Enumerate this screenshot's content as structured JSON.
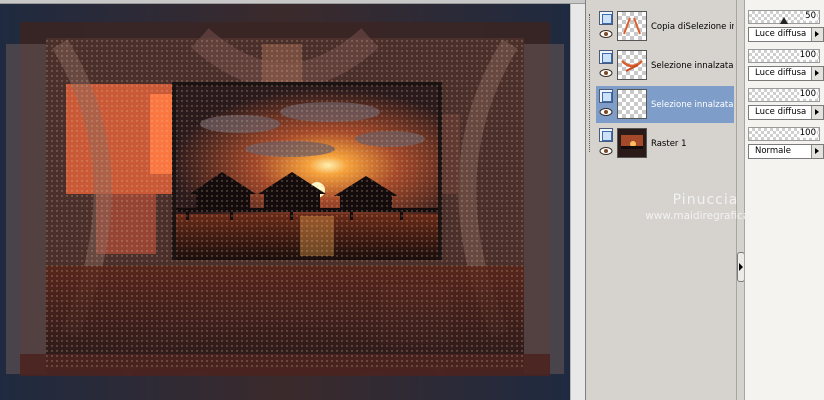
{
  "canvas": {
    "image_description_label": "Sunset over overwater bungalows collage"
  },
  "layers_palette": {
    "layers": [
      {
        "name": "Copia diSelezione in",
        "selected": false,
        "thumb_icon": "orange-strokes"
      },
      {
        "name": "Selezione innalzata",
        "selected": false,
        "thumb_icon": "orange-x-shape"
      },
      {
        "name": "Selezione innalzata 1",
        "selected": true,
        "thumb_icon": "empty-transparent"
      },
      {
        "name": "Raster 1",
        "selected": false,
        "thumb_icon": "photo-thumbnail"
      }
    ],
    "properties": [
      {
        "opacity": "50",
        "blend_mode": "Luce diffusa"
      },
      {
        "opacity": "100",
        "blend_mode": "Luce diffusa"
      },
      {
        "opacity": "100",
        "blend_mode": "Luce diffusa"
      },
      {
        "opacity": "100",
        "blend_mode": "Normale"
      }
    ],
    "selected_color": "#7e9dc8"
  },
  "watermark": {
    "line1": "Pinuccia",
    "line2": "www.maidiregrafica.eu"
  }
}
